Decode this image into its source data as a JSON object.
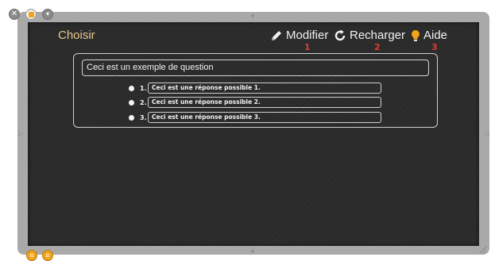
{
  "window": {
    "close_glyph": "✕",
    "menu_glyph": "▾"
  },
  "header": {
    "title": "Choisir",
    "tools": [
      {
        "label": "Modifier",
        "icon": "pencil-icon",
        "marker": "1"
      },
      {
        "label": "Recharger",
        "icon": "reload-icon",
        "marker": "2"
      },
      {
        "label": "Aide",
        "icon": "lightbulb-icon",
        "marker": "3"
      }
    ]
  },
  "question": {
    "text": "Ceci est un exemple de question",
    "answers": [
      {
        "number": "1.",
        "text": "Ceci est une réponse possible 1."
      },
      {
        "number": "2.",
        "text": "Ceci est une réponse possible 2."
      },
      {
        "number": "3.",
        "text": "Ceci est une réponse possible 3."
      }
    ]
  },
  "colors": {
    "board_background": "#2d2d2d",
    "frame": "#a9a9a9",
    "title": "#e8c48f",
    "marker_red": "#e03b2a",
    "accent_orange": "#f2a31b",
    "lightbulb": "#f2a31b"
  }
}
